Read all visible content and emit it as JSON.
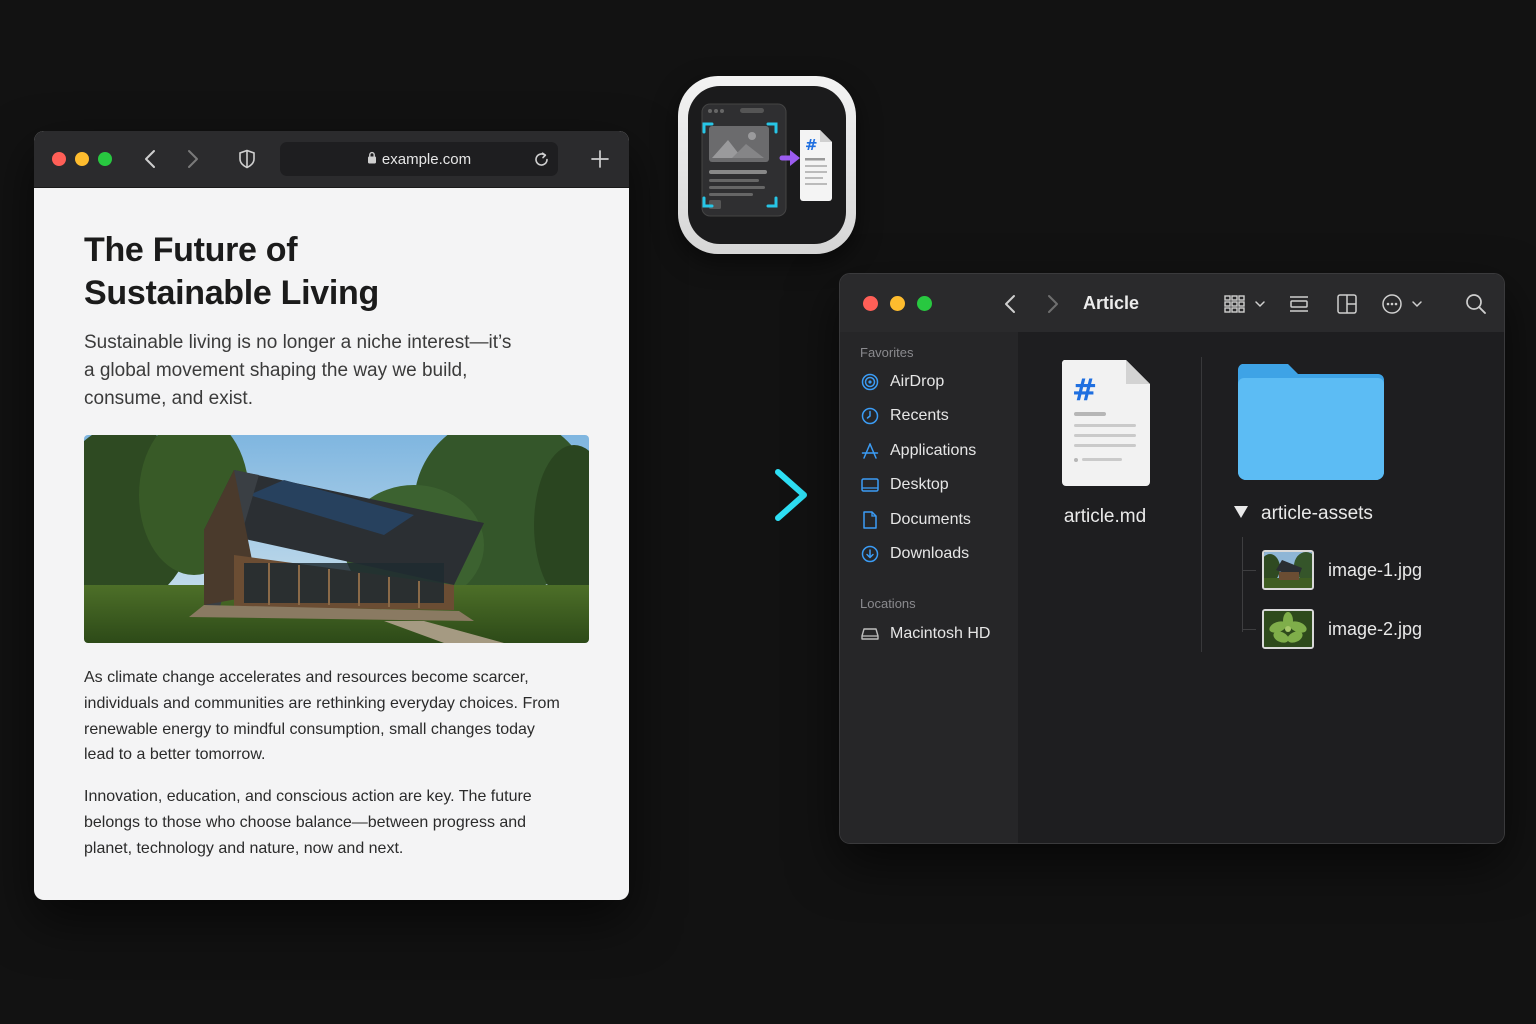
{
  "browser": {
    "url": "example.com",
    "article": {
      "title": "The Future of Sustainable Living",
      "lede": "Sustainable living is no longer a niche interest—it’s a global movement shaping the way we build, consume, and exist.",
      "paragraphs": [
        "As climate change accelerates and resources become scarcer, individuals and communities are rethinking everyday choices. From renewable energy to mindful consumption, small changes today lead to a better tomorrow.",
        "Innovation, education, and conscious action are key. The future belongs to those who choose balance—between progress and planet, technology and nature, now and next."
      ]
    }
  },
  "finder": {
    "title": "Article",
    "sidebar": {
      "favorites_heading": "Favorites",
      "favorites": [
        {
          "label": "AirDrop",
          "icon": "airdrop-icon"
        },
        {
          "label": "Recents",
          "icon": "clock-icon"
        },
        {
          "label": "Applications",
          "icon": "applications-icon"
        },
        {
          "label": "Desktop",
          "icon": "desktop-icon"
        },
        {
          "label": "Documents",
          "icon": "document-icon"
        },
        {
          "label": "Downloads",
          "icon": "download-icon"
        }
      ],
      "locations_heading": "Locations",
      "locations": [
        {
          "label": "Macintosh HD",
          "icon": "disk-icon"
        }
      ]
    },
    "files": {
      "markdown": {
        "name": "article.md",
        "icon": "markdown-file-icon"
      },
      "folder": {
        "name": "article-assets",
        "icon": "folder-icon"
      },
      "images": [
        {
          "name": "image-1.jpg"
        },
        {
          "name": "image-2.jpg"
        }
      ]
    }
  },
  "colors": {
    "accent": "#2ec8e8",
    "sidebar_icon": "#3b9cf5",
    "folder": "#56b7f2",
    "markdown_hash": "#1f6fe0"
  }
}
